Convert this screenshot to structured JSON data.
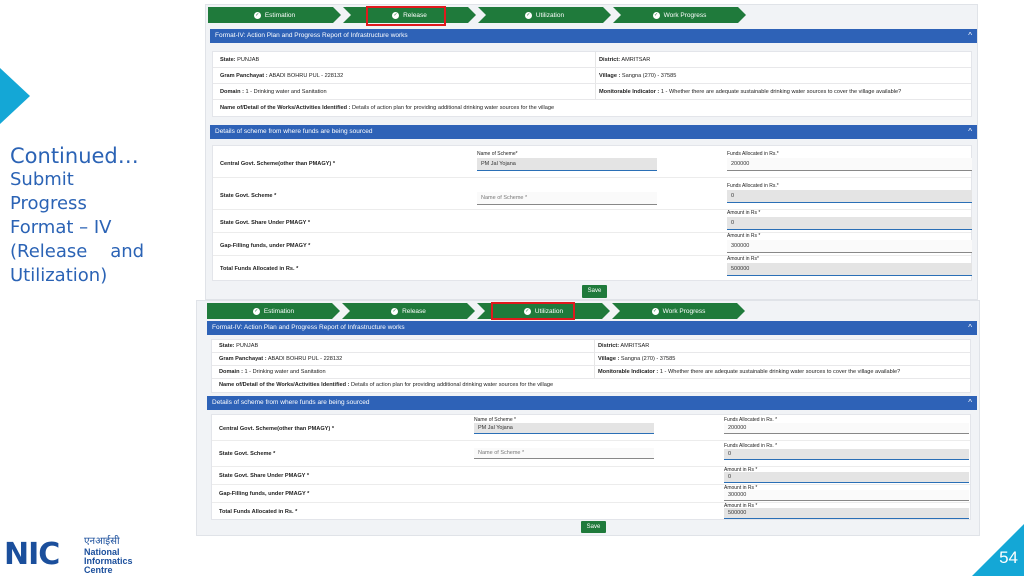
{
  "slide": {
    "title_line1": "Continued…",
    "title_rest": "Submit\nProgress\nFormat – IV\n(Release    and\nUtilization)",
    "page_number": "54",
    "logo": {
      "mark": "NIC",
      "hindi": "एनआईसी",
      "line1": "National",
      "line2": "Informatics",
      "line3": "Centre"
    }
  },
  "steps": [
    "Estimation",
    "Release",
    "Utilization",
    "Work Progress"
  ],
  "report": {
    "title": "Format-IV: Action Plan and Progress Report of Infrastructure works",
    "state_label": "State:",
    "state_value": "PUNJAB",
    "district_label": "District:",
    "district_value": "AMRITSAR",
    "gp_label": "Gram Panchayat :",
    "gp_value": "ABADI BOHRU PUL - 228132",
    "village_label": "Village :",
    "village_value": "Sangna (270) - 37585",
    "domain_label": "Domain :",
    "domain_value": "1 - Drinking water and Sanitation",
    "indicator_label": "Monitorable Indicator :",
    "indicator_value": "1 - Whether there are adequate sustainable drinking water sources to cover the village available?",
    "works_label": "Name of/Detail of the Works/Activities Identified :",
    "works_value": "Details of action plan for providing additional drinking water sources for the village"
  },
  "funds": {
    "title": "Details of scheme from where funds are being sourced",
    "central_label": "Central Govt. Scheme(other than PMAGY)",
    "state_label": "State Govt. Scheme",
    "state_share_label": "State Govt. Share Under PMAGY",
    "gap_label": "Gap-Filling funds, under PMAGY",
    "total_label": "Total Funds Allocated in Rs.",
    "required": "*",
    "name_of_scheme_label": "Name of Scheme",
    "funds_alloc_label": "Funds Allocated in Rs.",
    "amount_label": "Amount in Rs",
    "central_scheme_value": "PM Jal Yojana",
    "state_scheme_placeholder": "Name of Scheme",
    "central_funds": "200000",
    "state_funds": "0",
    "state_share_amount": "0",
    "gap_amount": "300000",
    "total_amount": "500000",
    "save_label": "Save"
  },
  "colors": {
    "accent": "#2e62b7",
    "step": "#1f7a3b",
    "highlight": "#e0191d",
    "decor": "#14a7d6"
  }
}
